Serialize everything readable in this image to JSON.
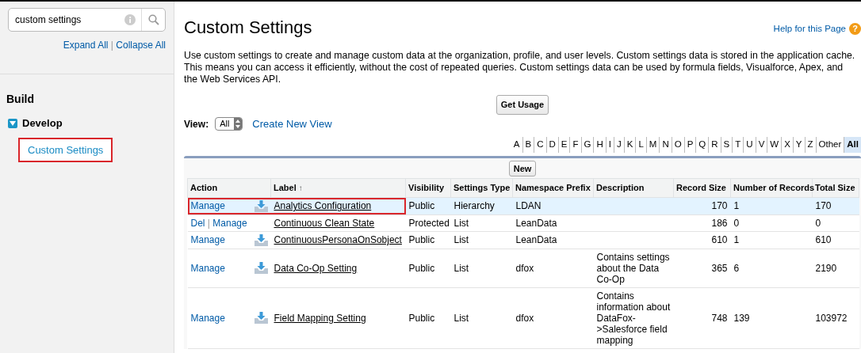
{
  "sidebar": {
    "search": {
      "value": "custom settings"
    },
    "expand_all": "Expand All",
    "separator": "|",
    "collapse_all": "Collapse All",
    "section": "Build",
    "tree": [
      {
        "label": "Develop",
        "expanded": true,
        "children": [
          {
            "label": "Custom Settings",
            "selected": true,
            "highlighted": true
          }
        ]
      }
    ]
  },
  "page": {
    "title": "Custom Settings",
    "help_link": "Help for this Page",
    "help_icon": "?",
    "description": "Use custom settings to create and manage custom data at the organization, profile, and user levels. Custom settings data is stored in the application cache. This means you can access it efficiently, without the cost of repeated queries. Custom settings data can be used by formula fields, Visualforce, Apex, and the Web Services API.",
    "get_usage_button": "Get Usage",
    "view_label": "View:",
    "view_select": "All",
    "create_view_link": "Create New View",
    "letters": [
      {
        "label": "A",
        "selected": false
      },
      {
        "label": "B",
        "selected": false
      },
      {
        "label": "C",
        "selected": false
      },
      {
        "label": "D",
        "selected": false
      },
      {
        "label": "E",
        "selected": false
      },
      {
        "label": "F",
        "selected": false
      },
      {
        "label": "G",
        "selected": false
      },
      {
        "label": "H",
        "selected": false
      },
      {
        "label": "I",
        "selected": false
      },
      {
        "label": "J",
        "selected": false
      },
      {
        "label": "K",
        "selected": false
      },
      {
        "label": "L",
        "selected": false
      },
      {
        "label": "M",
        "selected": false
      },
      {
        "label": "N",
        "selected": false
      },
      {
        "label": "O",
        "selected": false
      },
      {
        "label": "P",
        "selected": false
      },
      {
        "label": "Q",
        "selected": false
      },
      {
        "label": "R",
        "selected": false
      },
      {
        "label": "S",
        "selected": false
      },
      {
        "label": "T",
        "selected": false
      },
      {
        "label": "U",
        "selected": false
      },
      {
        "label": "V",
        "selected": false
      },
      {
        "label": "W",
        "selected": false
      },
      {
        "label": "X",
        "selected": false
      },
      {
        "label": "Y",
        "selected": false
      },
      {
        "label": "Z",
        "selected": false
      },
      {
        "label": "Other",
        "selected": false
      },
      {
        "label": "All",
        "selected": true
      }
    ],
    "new_button": "New"
  },
  "table": {
    "columns": [
      "Action",
      "Label",
      "Visibility",
      "Settings Type",
      "Namespace Prefix",
      "Description",
      "Record Size",
      "Number of Records",
      "Total Size"
    ],
    "sort_indicator": "↑",
    "rows": [
      {
        "actions": [
          "Manage"
        ],
        "installed": true,
        "label": "Analytics Configuration",
        "visibility": "Public",
        "settings_type": "Hierarchy",
        "namespace_prefix": "LDAN",
        "description": "",
        "record_size": "170",
        "number_of_records": "1",
        "total_size": "170",
        "selected": true,
        "highlighted": true
      },
      {
        "actions": [
          "Del",
          "Manage"
        ],
        "separator": "|",
        "installed": false,
        "label": "Continuous Clean State",
        "visibility": "Protected",
        "settings_type": "List",
        "namespace_prefix": "LeanData",
        "description": "",
        "record_size": "186",
        "number_of_records": "0",
        "total_size": "0",
        "selected": false,
        "highlighted": false
      },
      {
        "actions": [
          "Manage"
        ],
        "installed": true,
        "label": "ContinuousPersonaOnSobject",
        "visibility": "Public",
        "settings_type": "List",
        "namespace_prefix": "LeanData",
        "description": "",
        "record_size": "610",
        "number_of_records": "1",
        "total_size": "610",
        "selected": false,
        "highlighted": false
      },
      {
        "actions": [
          "Manage"
        ],
        "installed": true,
        "label": "Data Co-Op Setting",
        "visibility": "Public",
        "settings_type": "List",
        "namespace_prefix": "dfox",
        "description": "Contains settings about the Data Co-Op",
        "record_size": "365",
        "number_of_records": "6",
        "total_size": "2190",
        "selected": false,
        "highlighted": false
      },
      {
        "actions": [
          "Manage"
        ],
        "installed": true,
        "label": "Field Mapping Setting",
        "visibility": "Public",
        "settings_type": "List",
        "namespace_prefix": "dfox",
        "description": "Contains information about DataFox->Salesforce field mapping",
        "record_size": "748",
        "number_of_records": "139",
        "total_size": "103972",
        "selected": false,
        "highlighted": false
      }
    ]
  }
}
